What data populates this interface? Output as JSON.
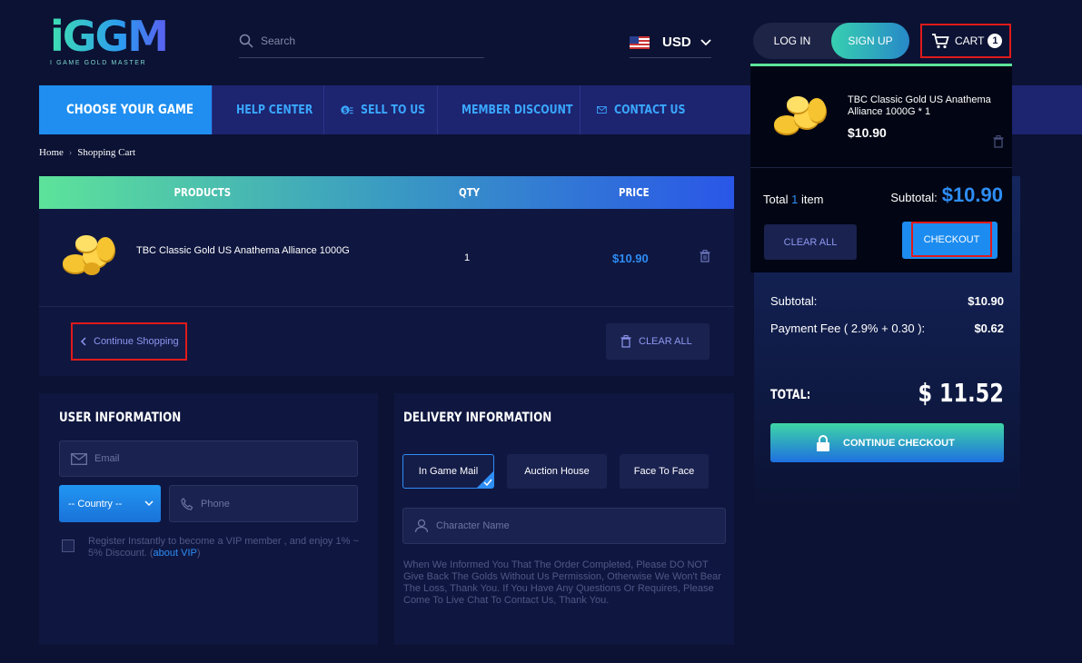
{
  "logo": {
    "main": "iGGM",
    "sub": "I GAME GOLD MASTER"
  },
  "search": {
    "placeholder": "Search"
  },
  "currency": {
    "code": "USD"
  },
  "auth": {
    "login": "LOG IN",
    "signup": "SIGN UP"
  },
  "cart": {
    "label": "CART",
    "count": "1"
  },
  "nav": {
    "choose_game": "CHOOSE YOUR GAME",
    "items": [
      "HELP CENTER",
      "SELL TO US",
      "MEMBER DISCOUNT",
      "CONTACT US"
    ]
  },
  "breadcrumb": {
    "home": "Home",
    "current": "Shopping Cart"
  },
  "table": {
    "headers": {
      "products": "PRODUCTS",
      "qty": "QTY",
      "price": "PRICE"
    },
    "rows": [
      {
        "name": "TBC Classic Gold US Anathema Alliance 1000G",
        "qty": "1",
        "price": "$10.90"
      }
    ],
    "continue_shopping": "Continue Shopping",
    "clear_all": "CLEAR ALL"
  },
  "user_info": {
    "title": "USER INFORMATION",
    "email_placeholder": "Email",
    "country": "-- Country --",
    "phone_placeholder": "Phone",
    "vip_text": "Register Instantly to become a VIP member , and enjoy 1% ~ 5% Discount. (",
    "vip_link": "about VIP",
    "vip_close": ")"
  },
  "delivery": {
    "title": "DELIVERY INFORMATION",
    "options": [
      "In Game Mail",
      "Auction House",
      "Face To Face"
    ],
    "selected": "In Game Mail",
    "character_placeholder": "Character Name",
    "note": "When We Informed You That The Order Completed, Please DO NOT Give Back The Golds Without Us Permission, Otherwise We Won't Bear The Loss, Thank You. If You Have Any Questions Or Requires, Please Come To Live Chat To Contact Us, Thank You."
  },
  "summary": {
    "subtotal_label": "Subtotal:",
    "subtotal": "$10.90",
    "fee_label": "Payment Fee ( 2.9% + 0.30 ):",
    "fee": "$0.62",
    "total_label": "TOTAL:",
    "total": "$ 11.52",
    "continue_checkout": "CONTINUE CHECKOUT"
  },
  "dropdown": {
    "item_name": "TBC Classic Gold US Anathema Alliance 1000G * 1",
    "item_price": "$10.90",
    "total_prefix": "Total",
    "total_count": "1",
    "total_suffix": "item",
    "subtotal_label": "Subtotal:",
    "subtotal": "$10.90",
    "clear_all": "CLEAR ALL",
    "checkout": "CHECKOUT"
  },
  "colors": {
    "accent": "#2e8df5",
    "highlight": "#e01a1a",
    "background": "#0b1233"
  }
}
